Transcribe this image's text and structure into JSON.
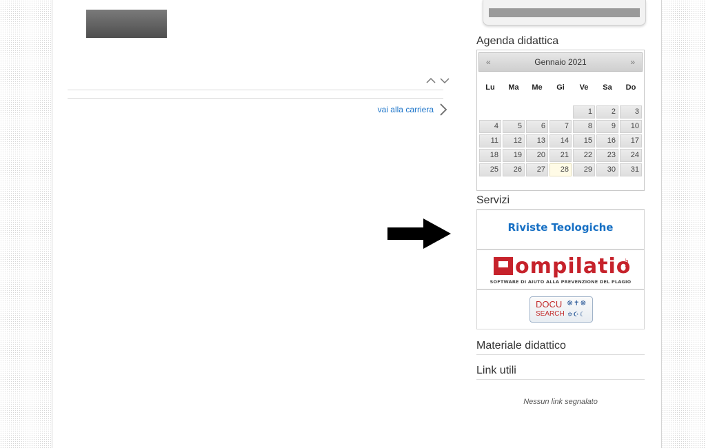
{
  "main": {
    "career_link": "vai alla carriera",
    "icons": [
      "chevron-up-icon",
      "chevron-down-icon",
      "chevron-right-icon",
      "arrow-right-icon"
    ]
  },
  "sidebar": {
    "agenda_title": "Agenda didattica",
    "calendar": {
      "month_label": "Gennaio 2021",
      "prev_label": "«",
      "next_label": "»",
      "weekdays": [
        "Lu",
        "Ma",
        "Me",
        "Gi",
        "Ve",
        "Sa",
        "Do"
      ],
      "leading_blanks": 4,
      "days": 31,
      "today": 28
    },
    "servizi_title": "Servizi",
    "services": {
      "riviste": "Riviste Teologiche",
      "compilatio_logo": "ompilatio",
      "compilatio_suffix": ".net",
      "compilatio_tagline": "SOFTWARE DI AIUTO ALLA PREVENZIONE DEL PLAGIO",
      "docu_line1": "DOCU",
      "docu_line2": "SEARCH",
      "docu_symbols1": "☸✝☸",
      "docu_symbols2": "✡☪☾"
    },
    "materiale_title": "Materiale didattico",
    "link_title": "Link utili",
    "no_links": "Nessun link segnalato"
  },
  "colors": {
    "link": "#1a73c9",
    "riviste": "#1770c4",
    "compilatio": "#c6222b",
    "today_bg": "#fffbe6"
  }
}
